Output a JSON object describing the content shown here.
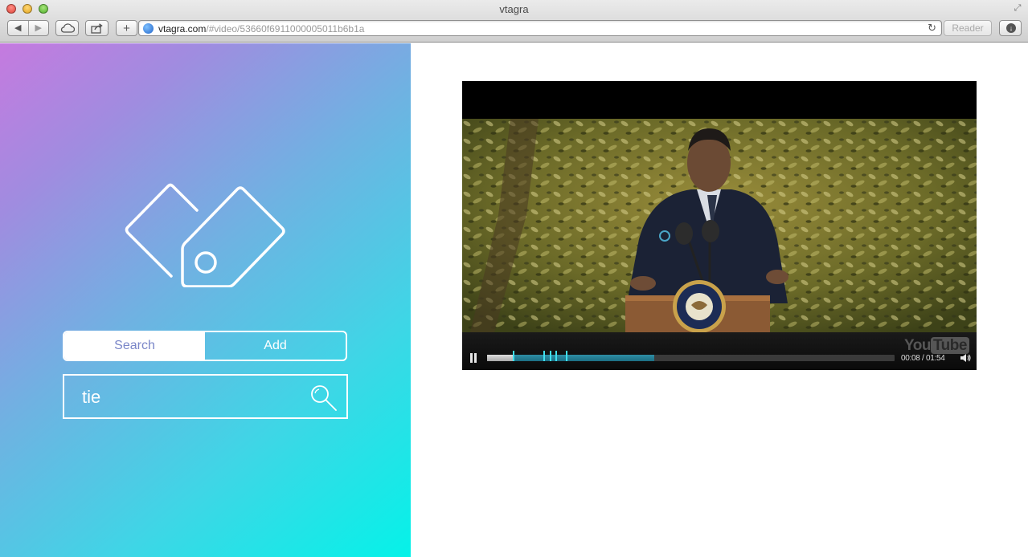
{
  "window": {
    "title": "vtagra"
  },
  "toolbar": {
    "back_glyph": "◀",
    "forward_glyph": "▶",
    "new_tab_glyph": "+",
    "reload_glyph": "↻",
    "reader_label": "Reader",
    "download_glyph": "↓"
  },
  "address": {
    "host": "vtagra.com",
    "path": "/#video/53660f6911000005011b6b1a"
  },
  "panel": {
    "modes": [
      {
        "label": "Search",
        "active": true
      },
      {
        "label": "Add",
        "active": false
      }
    ],
    "search": {
      "value": "tie",
      "placeholder": ""
    }
  },
  "player": {
    "time_label": "00:08 / 01:54",
    "watermark_left": "You",
    "watermark_right": "Tube",
    "progress": {
      "played_fraction": 0.066,
      "buffered_fraction": 0.41
    },
    "tag_marks_fraction": [
      0.066,
      0.14,
      0.155,
      0.17,
      0.195
    ]
  },
  "colors": {
    "gradient_top_left": "#c57adf",
    "gradient_bottom_right": "#05f2e8",
    "toggle_active_text": "#7a86c8",
    "progress_buffer": "#2e8ea5",
    "tag_mark": "#3fe0ee"
  },
  "icons": {
    "logo": "tags-icon",
    "search": "magnifier-icon",
    "pause": "pause-icon",
    "volume": "speaker-icon"
  }
}
